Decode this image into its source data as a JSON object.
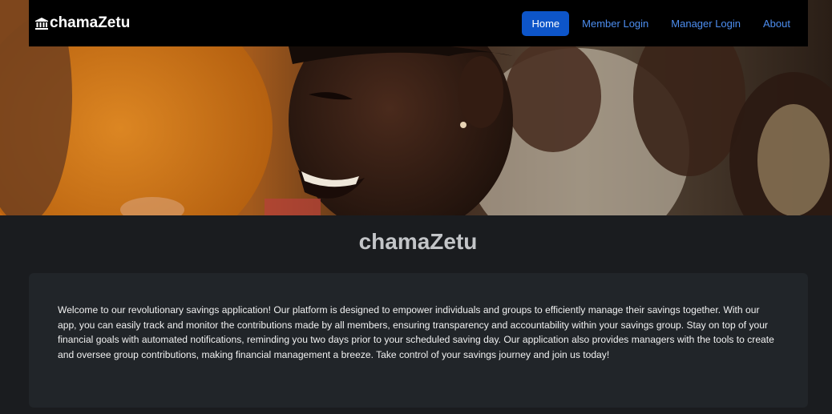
{
  "brand": {
    "name": "chamaZetu",
    "icon": "bank-icon"
  },
  "nav": {
    "items": [
      {
        "label": "Home",
        "active": true
      },
      {
        "label": "Member Login",
        "active": false
      },
      {
        "label": "Manager Login",
        "active": false
      },
      {
        "label": "About",
        "active": false
      }
    ]
  },
  "hero": {
    "description": ""
  },
  "main": {
    "title": "chamaZetu",
    "body": "Welcome to our revolutionary savings application! Our platform is designed to empower individuals and groups to efficiently manage their savings together. With our app, you can easily track and monitor the contributions made by all members, ensuring transparency and accountability within your savings group. Stay on top of your financial goals with automated notifications, reminding you two days prior to your scheduled saving day. Our application also provides managers with the tools to create and oversee group contributions, making financial management a breeze. Take control of your savings journey and join us today!"
  },
  "colors": {
    "navbar_bg": "#000000",
    "active_nav_bg": "#0d55c9",
    "link": "#4d8ef0",
    "page_bg": "#1a1c1f",
    "card_bg": "#212529"
  }
}
